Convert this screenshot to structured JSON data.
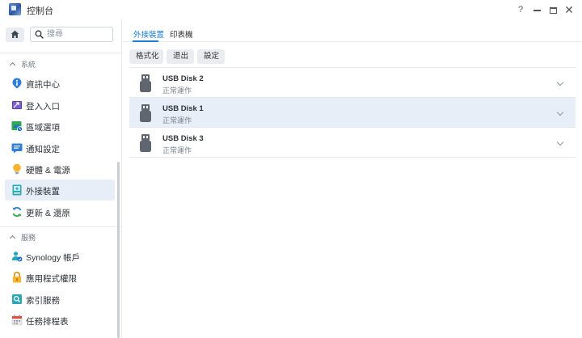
{
  "window": {
    "title": "控制台",
    "controls": {
      "help": "?",
      "close": "✕"
    }
  },
  "sidebar": {
    "search_placeholder": "搜尋",
    "sections": [
      {
        "header": "系統",
        "items": [
          {
            "label": "資訊中心",
            "icon": "info-icon"
          },
          {
            "label": "登入入口",
            "icon": "login-portal-icon"
          },
          {
            "label": "區域選項",
            "icon": "regional-options-icon"
          },
          {
            "label": "通知設定",
            "icon": "notification-icon"
          },
          {
            "label": "硬體 & 電源",
            "icon": "hardware-power-icon"
          },
          {
            "label": "外接裝置",
            "icon": "external-devices-icon",
            "active": true
          },
          {
            "label": "更新 & 還原",
            "icon": "update-restore-icon"
          }
        ]
      },
      {
        "header": "服務",
        "items": [
          {
            "label": "Synology 帳戶",
            "icon": "synology-account-icon"
          },
          {
            "label": "應用程式權限",
            "icon": "app-privileges-icon"
          },
          {
            "label": "索引服務",
            "icon": "indexing-service-icon"
          },
          {
            "label": "任務排程表",
            "icon": "task-scheduler-icon"
          }
        ]
      }
    ]
  },
  "main": {
    "tabs": [
      {
        "label": "外接裝置",
        "active": true
      },
      {
        "label": "印表機",
        "active": false
      }
    ],
    "toolbar": {
      "format": "格式化",
      "eject": "退出",
      "settings": "設定"
    },
    "devices": [
      {
        "name": "USB Disk 2",
        "status": "正常運作",
        "selected": false
      },
      {
        "name": "USB Disk 1",
        "status": "正常運作",
        "selected": true
      },
      {
        "name": "USB Disk 3",
        "status": "正常運作",
        "selected": false
      }
    ]
  },
  "colors": {
    "accent": "#1b7ed6",
    "selected_bg": "#e8eef7",
    "button_bg": "#e9edf2",
    "divider": "#e6e9ed"
  }
}
